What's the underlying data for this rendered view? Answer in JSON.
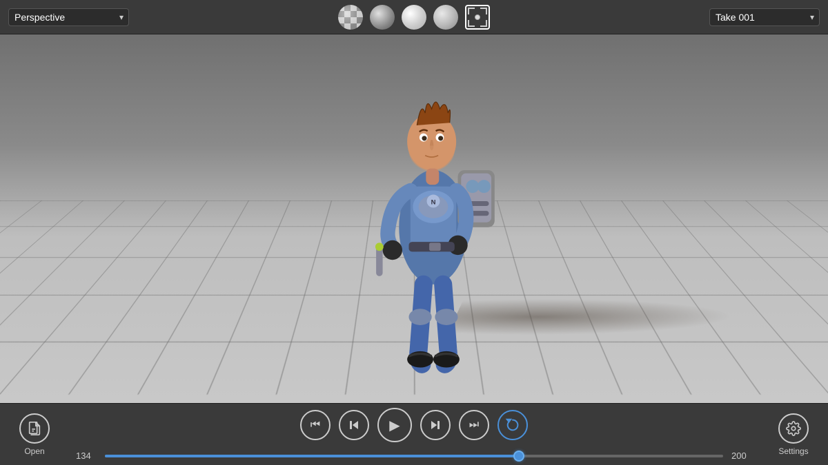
{
  "toolbar": {
    "perspective_label": "Perspective",
    "take_label": "Take 001",
    "sphere_icons": [
      {
        "name": "checkerboard-sphere",
        "title": "Checkerboard"
      },
      {
        "name": "gray-sphere",
        "title": "Gray"
      },
      {
        "name": "white-sphere",
        "title": "White"
      },
      {
        "name": "light-sphere",
        "title": "Light"
      }
    ]
  },
  "viewport": {
    "character_alt": "3D character - space suit astronaut"
  },
  "bottom_controls": {
    "open_label": "Open",
    "settings_label": "Settings",
    "timeline_start": "134",
    "timeline_end": "200",
    "timeline_progress": 67,
    "playback_buttons": [
      {
        "name": "skip-to-start",
        "icon": "⏮",
        "title": "Skip to Start"
      },
      {
        "name": "step-back",
        "icon": "⏪",
        "title": "Step Back"
      },
      {
        "name": "play",
        "icon": "▶",
        "title": "Play"
      },
      {
        "name": "step-forward-frame",
        "icon": "⏩",
        "title": "Step Forward"
      },
      {
        "name": "skip-to-end",
        "icon": "⏭",
        "title": "Skip to End"
      },
      {
        "name": "loop",
        "icon": "↻",
        "title": "Loop"
      }
    ]
  }
}
